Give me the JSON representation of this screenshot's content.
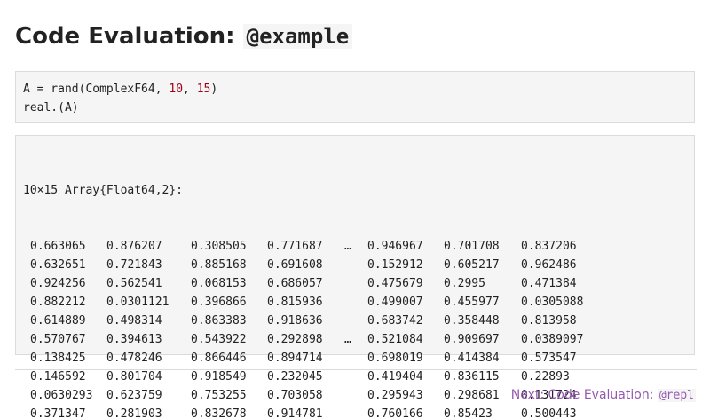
{
  "page": {
    "title_text": "Code Evaluation: ",
    "title_code": "@example"
  },
  "input": {
    "line1_prefix": "A = rand(ComplexF64, ",
    "line1_arg1": "10",
    "line1_sep": ", ",
    "line1_arg2": "15",
    "line1_suffix": ")",
    "line2": "real.(A)"
  },
  "output": {
    "header": "10×15 Array{Float64,2}:",
    "rows": [
      [
        "0.663065",
        "0.876207",
        "0.308505",
        "0.771687",
        "…",
        "0.946967",
        "0.701708",
        "0.837206"
      ],
      [
        "0.632651",
        "0.721843",
        "0.885168",
        "0.691608",
        "",
        "0.152912",
        "0.605217",
        "0.962486"
      ],
      [
        "0.924256",
        "0.562541",
        "0.068153",
        "0.686057",
        "",
        "0.475679",
        "0.2995",
        "0.471384"
      ],
      [
        "0.882212",
        "0.0301121",
        "0.396866",
        "0.815936",
        "",
        "0.499007",
        "0.455977",
        "0.0305088"
      ],
      [
        "0.614889",
        "0.498314",
        "0.863383",
        "0.918636",
        "",
        "0.683742",
        "0.358448",
        "0.813958"
      ],
      [
        "0.570767",
        "0.394613",
        "0.543922",
        "0.292898",
        "…",
        "0.521084",
        "0.909697",
        "0.0389097"
      ],
      [
        "0.138425",
        "0.478246",
        "0.866446",
        "0.894714",
        "",
        "0.698019",
        "0.414384",
        "0.573547"
      ],
      [
        "0.146592",
        "0.801704",
        "0.918549",
        "0.232045",
        "",
        "0.419404",
        "0.836115",
        "0.22893"
      ],
      [
        "0.0630293",
        "0.623759",
        "0.753255",
        "0.703058",
        "",
        "0.295943",
        "0.298681",
        "0.131724"
      ],
      [
        "0.371347",
        "0.281903",
        "0.832678",
        "0.914781",
        "",
        "0.760166",
        "0.85423",
        "0.500443"
      ]
    ]
  },
  "footer": {
    "next_text": "Next: Code Evaluation: ",
    "next_code": "@repl"
  },
  "colors": {
    "link": "#9558b2",
    "number_literal": "#a3001a",
    "code_background": "#f5f5f5",
    "border": "#dbdbdb"
  }
}
